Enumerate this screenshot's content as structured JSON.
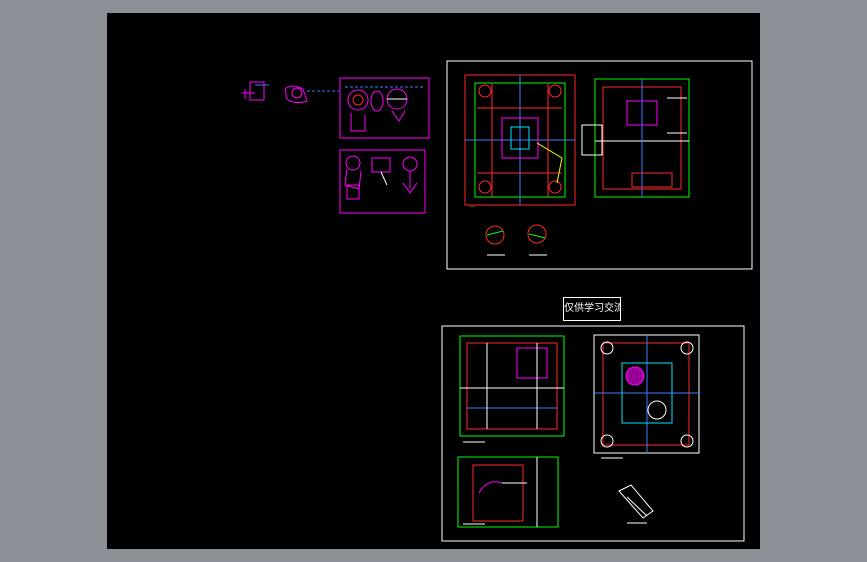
{
  "viewport": {
    "background_color": "#000000",
    "frame_color": "#8c9198"
  },
  "note_label": {
    "text": "仅供学习交流"
  },
  "colors": {
    "magenta": "#ff00ff",
    "red": "#ff2a2a",
    "green": "#00ff00",
    "blue": "#3b7bff",
    "cyan": "#00e5ff",
    "white": "#ffffff",
    "yellow": "#ffff00"
  }
}
